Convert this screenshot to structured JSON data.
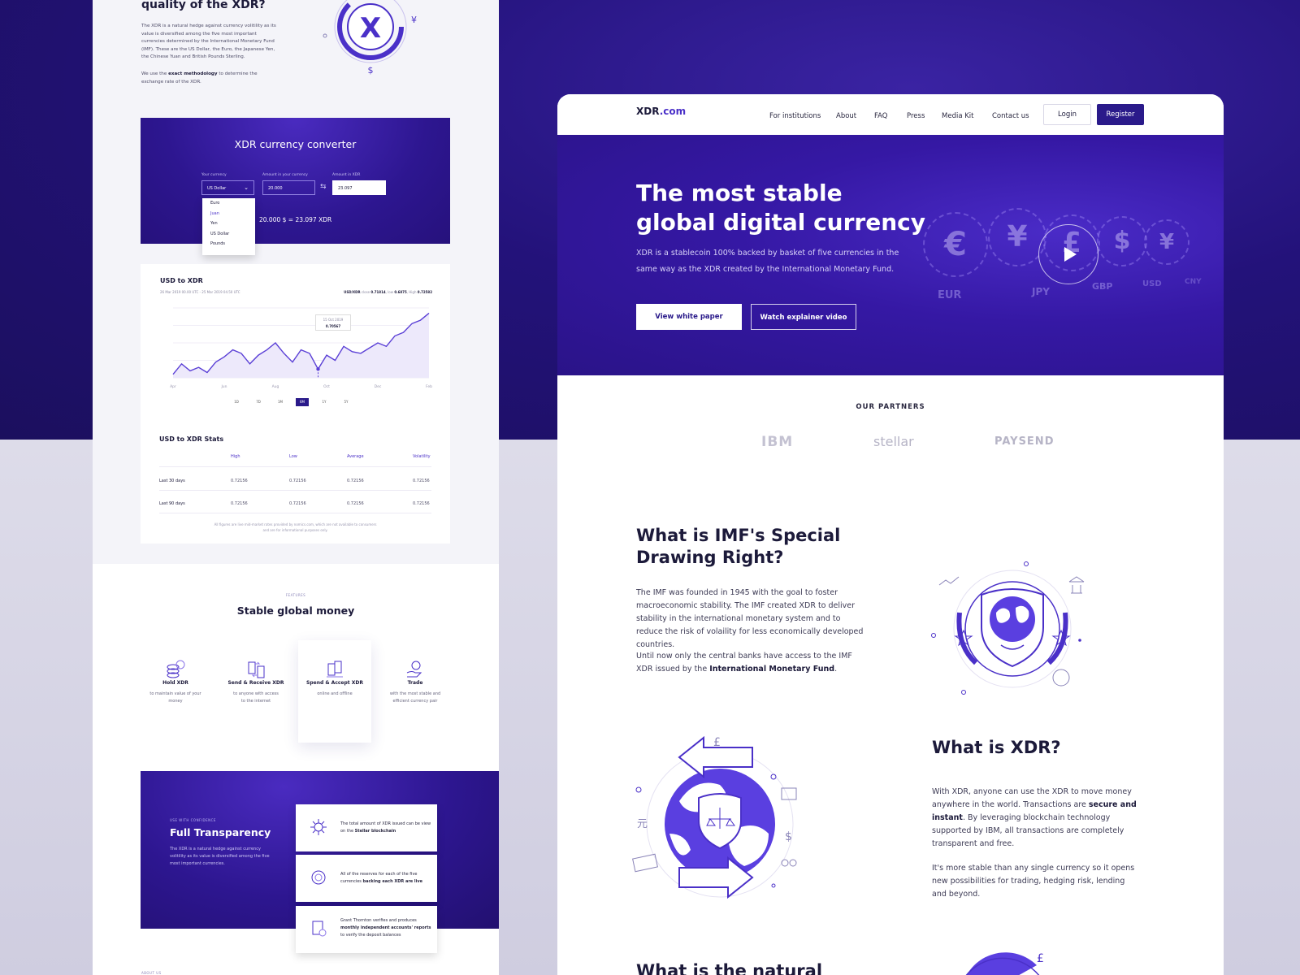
{
  "left": {
    "quality_title": "quality of the XDR?",
    "quality_p1": "The XDR is a natural hedge against currency volitility as its value is diversified among the five most important currencies determined by the International Monetary Fund (IMF). These are the US Dollar, the Euro, the Japanese Yen, the Chinese Yuan and British Pounds Sterling.",
    "quality_p2_pre": "We use the",
    "quality_p2_bold": "exact methodology",
    "quality_p2_post": "to determine the exchange rate of the XDR.",
    "converter": {
      "title": "XDR currency converter",
      "your_currency_label": "Your currency",
      "selected": "US Dollar",
      "amount_label": "Amount in your currency",
      "amount_value": "20.000",
      "xdr_label": "Amount in XDR",
      "xdr_value": "23.097",
      "options": [
        "Euro",
        "Juan",
        "Yen",
        "US Dollar",
        "Pounds"
      ],
      "result": "20.000 $ = 23.097 XDR"
    },
    "chart_card": {
      "title": "USD to XDR",
      "range": "26 Mar 2019 00.00 UTC - 25 Mar 2019 04.50 UTC",
      "pair": "USD/XDR",
      "close_label": "close",
      "close_value": "0.71814",
      "low_label": "low",
      "low_value": "0.6875",
      "high_label": "High",
      "high_value": "0.72582",
      "tooltip_date": "15 Oct 2019",
      "tooltip_value": "0.70567",
      "timeframes": [
        "1D",
        "7D",
        "1M",
        "6M",
        "1Y",
        "5Y"
      ],
      "active_timeframe": "6M"
    },
    "stats": {
      "title": "USD to XDR Stats",
      "headers": [
        "High",
        "Low",
        "Average",
        "Volatility"
      ],
      "rows": [
        {
          "label": "Last 30 days",
          "values": [
            "0.72156",
            "0.72156",
            "0.72156",
            "0.72156"
          ]
        },
        {
          "label": "Last 90 days",
          "values": [
            "0.72156",
            "0.72156",
            "0.72156",
            "0.72156"
          ]
        }
      ],
      "note1": "All figures are live mid-market rates provided by nomics.com, which are not available to consumers",
      "note2": "and are for informational purposes only."
    },
    "features": {
      "kicker": "FEATURES",
      "title": "Stable global money",
      "items": [
        {
          "title": "Hold XDR",
          "desc1": "to maintain value of your",
          "desc2": "money"
        },
        {
          "title": "Send & Receive XDR",
          "desc1": "to anyone with access",
          "desc2": "to the internet"
        },
        {
          "title": "Spend & Accept XDR",
          "desc1": "online and offline",
          "desc2": ""
        },
        {
          "title": "Trade",
          "desc1": "with the most stable and",
          "desc2": "efficient currency pair"
        }
      ]
    },
    "transparency": {
      "kicker": "USE WITH CONFIDENCE",
      "title": "Full Transparency",
      "desc": "The XDR is a natural hedge against currency volitility as its value is diversified among the five most important currencies.",
      "card1_pre": "The total amount of XDR issued can be view on the",
      "card1_bold": "Stellar blockchain",
      "card2_pre": "All of the reserves for each of the five currencies",
      "card2_bold": "backing each XDR are live",
      "card3_pre": "Grant Thornton verifies and produces",
      "card3_bold": "monthly independent accounts' reports",
      "card3_post": "to verify the deposit balances"
    },
    "about_kicker": "ABOUT US"
  },
  "chart_data": {
    "type": "area",
    "x": [
      "Apr",
      "Jun",
      "Aug",
      "Oct",
      "Dec",
      "Feb"
    ],
    "values": [
      0.702,
      0.708,
      0.704,
      0.706,
      0.703,
      0.709,
      0.712,
      0.716,
      0.714,
      0.708,
      0.713,
      0.716,
      0.72,
      0.714,
      0.709,
      0.716,
      0.714,
      0.705,
      0.713,
      0.71,
      0.718,
      0.715,
      0.714,
      0.717,
      0.72,
      0.718,
      0.724,
      0.726,
      0.731,
      0.733,
      0.737
    ],
    "ylim": [
      0.7,
      0.74
    ],
    "highlight_index": 17,
    "fill": "#ede9fb",
    "stroke": "#5b40d6"
  },
  "right": {
    "logo_main": "XDR",
    "logo_suffix": ".com",
    "nav": [
      "For institutions",
      "About",
      "FAQ",
      "Press",
      "Media Kit",
      "Contact us"
    ],
    "login": "Login",
    "register": "Register",
    "hero": {
      "title_line1": "The most stable",
      "title_line2": "global digital currency",
      "desc": "XDR is a stablecoin 100% backed by basket of five currencies in the same way as the XDR created by the International Monetary Fund.",
      "btn_primary": "View white paper",
      "btn_secondary": "Watch explainer video",
      "coins": [
        {
          "symbol": "€",
          "code": "EUR"
        },
        {
          "symbol": "¥",
          "code": "JPY"
        },
        {
          "symbol": "£",
          "code": "GBP"
        },
        {
          "symbol": "$",
          "code": "USD"
        },
        {
          "symbol": "¥",
          "code": "CNY"
        }
      ]
    },
    "partners": {
      "title": "OUR PARTNERS",
      "logos": [
        "IBM",
        "stellar",
        "PAYSEND"
      ]
    },
    "sdr": {
      "title_line1": "What is IMF's Special",
      "title_line2": "Drawing Right?",
      "p1": "The IMF was founded in 1945 with the goal to foster macroeconomic stability. The IMF created XDR to deliver stability in the international monetary system and to reduce the risk of volaility for less economically developed countries.",
      "p2_pre": "Until now only the central banks have access to the IMF XDR issued by the",
      "p2_bold": "International Monetary Fund",
      "p2_post": "."
    },
    "xdr": {
      "title": "What is XDR?",
      "p1_pre": "With XDR, anyone can use the XDR to move money anywhere in the world. Transactions are",
      "p1_bold": "secure and instant",
      "p1_post": ". By leveraging blockchain technology supported by IBM, all transactions are completely transparent and free.",
      "p2": "It's more stable than any single currency so it opens new possibilities for trading, hedging risk, lending and beyond."
    },
    "natural_title": "What is the natural",
    "icon_symbols": {
      "yuan": "元",
      "dollar": "$",
      "pound": "£",
      "pi": "π",
      "yen": "¥"
    }
  }
}
